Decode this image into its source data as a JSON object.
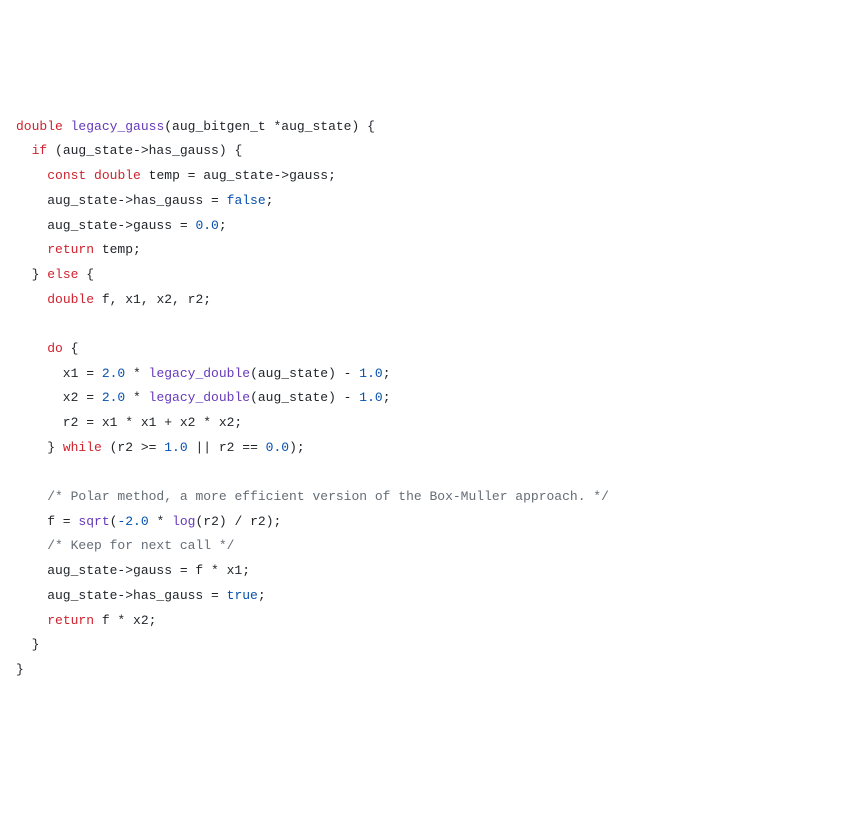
{
  "code": {
    "lines": [
      [
        {
          "cls": "tok-kw",
          "t": "double"
        },
        {
          "cls": "tok-txt",
          "t": " "
        },
        {
          "cls": "tok-fn",
          "t": "legacy_gauss"
        },
        {
          "cls": "tok-txt",
          "t": "(aug_bitgen_t *aug_state) {"
        }
      ],
      [
        {
          "cls": "tok-txt",
          "t": "  "
        },
        {
          "cls": "tok-kw",
          "t": "if"
        },
        {
          "cls": "tok-txt",
          "t": " (aug_state->has_gauss) {"
        }
      ],
      [
        {
          "cls": "tok-txt",
          "t": "    "
        },
        {
          "cls": "tok-kw",
          "t": "const"
        },
        {
          "cls": "tok-txt",
          "t": " "
        },
        {
          "cls": "tok-kw",
          "t": "double"
        },
        {
          "cls": "tok-txt",
          "t": " temp = aug_state->gauss;"
        }
      ],
      [
        {
          "cls": "tok-txt",
          "t": "    aug_state->has_gauss = "
        },
        {
          "cls": "tok-bool",
          "t": "false"
        },
        {
          "cls": "tok-txt",
          "t": ";"
        }
      ],
      [
        {
          "cls": "tok-txt",
          "t": "    aug_state->gauss = "
        },
        {
          "cls": "tok-num",
          "t": "0.0"
        },
        {
          "cls": "tok-txt",
          "t": ";"
        }
      ],
      [
        {
          "cls": "tok-txt",
          "t": "    "
        },
        {
          "cls": "tok-kw",
          "t": "return"
        },
        {
          "cls": "tok-txt",
          "t": " temp;"
        }
      ],
      [
        {
          "cls": "tok-txt",
          "t": "  } "
        },
        {
          "cls": "tok-kw",
          "t": "else"
        },
        {
          "cls": "tok-txt",
          "t": " {"
        }
      ],
      [
        {
          "cls": "tok-txt",
          "t": "    "
        },
        {
          "cls": "tok-kw",
          "t": "double"
        },
        {
          "cls": "tok-txt",
          "t": " f, x1, x2, r2;"
        }
      ],
      [
        {
          "cls": "tok-txt",
          "t": ""
        }
      ],
      [
        {
          "cls": "tok-txt",
          "t": "    "
        },
        {
          "cls": "tok-kw",
          "t": "do"
        },
        {
          "cls": "tok-txt",
          "t": " {"
        }
      ],
      [
        {
          "cls": "tok-txt",
          "t": "      x1 = "
        },
        {
          "cls": "tok-num",
          "t": "2.0"
        },
        {
          "cls": "tok-txt",
          "t": " * "
        },
        {
          "cls": "tok-fn",
          "t": "legacy_double"
        },
        {
          "cls": "tok-txt",
          "t": "(aug_state) - "
        },
        {
          "cls": "tok-num",
          "t": "1.0"
        },
        {
          "cls": "tok-txt",
          "t": ";"
        }
      ],
      [
        {
          "cls": "tok-txt",
          "t": "      x2 = "
        },
        {
          "cls": "tok-num",
          "t": "2.0"
        },
        {
          "cls": "tok-txt",
          "t": " * "
        },
        {
          "cls": "tok-fn",
          "t": "legacy_double"
        },
        {
          "cls": "tok-txt",
          "t": "(aug_state) - "
        },
        {
          "cls": "tok-num",
          "t": "1.0"
        },
        {
          "cls": "tok-txt",
          "t": ";"
        }
      ],
      [
        {
          "cls": "tok-txt",
          "t": "      r2 = x1 * x1 + x2 * x2;"
        }
      ],
      [
        {
          "cls": "tok-txt",
          "t": "    } "
        },
        {
          "cls": "tok-kw",
          "t": "while"
        },
        {
          "cls": "tok-txt",
          "t": " (r2 >= "
        },
        {
          "cls": "tok-num",
          "t": "1.0"
        },
        {
          "cls": "tok-txt",
          "t": " || r2 == "
        },
        {
          "cls": "tok-num",
          "t": "0.0"
        },
        {
          "cls": "tok-txt",
          "t": ");"
        }
      ],
      [
        {
          "cls": "tok-txt",
          "t": ""
        }
      ],
      [
        {
          "cls": "tok-txt",
          "t": "    "
        },
        {
          "cls": "tok-cmt",
          "t": "/* Polar method, a more efficient version of the Box-Muller approach. */"
        }
      ],
      [
        {
          "cls": "tok-txt",
          "t": "    f = "
        },
        {
          "cls": "tok-fn",
          "t": "sqrt"
        },
        {
          "cls": "tok-txt",
          "t": "("
        },
        {
          "cls": "tok-num",
          "t": "-2.0"
        },
        {
          "cls": "tok-txt",
          "t": " * "
        },
        {
          "cls": "tok-fn",
          "t": "log"
        },
        {
          "cls": "tok-txt",
          "t": "(r2) / r2);"
        }
      ],
      [
        {
          "cls": "tok-txt",
          "t": "    "
        },
        {
          "cls": "tok-cmt",
          "t": "/* Keep for next call */"
        }
      ],
      [
        {
          "cls": "tok-txt",
          "t": "    aug_state->gauss = f * x1;"
        }
      ],
      [
        {
          "cls": "tok-txt",
          "t": "    aug_state->has_gauss = "
        },
        {
          "cls": "tok-bool",
          "t": "true"
        },
        {
          "cls": "tok-txt",
          "t": ";"
        }
      ],
      [
        {
          "cls": "tok-txt",
          "t": "    "
        },
        {
          "cls": "tok-kw",
          "t": "return"
        },
        {
          "cls": "tok-txt",
          "t": " f * x2;"
        }
      ],
      [
        {
          "cls": "tok-txt",
          "t": "  }"
        }
      ],
      [
        {
          "cls": "tok-txt",
          "t": "}"
        }
      ]
    ]
  }
}
